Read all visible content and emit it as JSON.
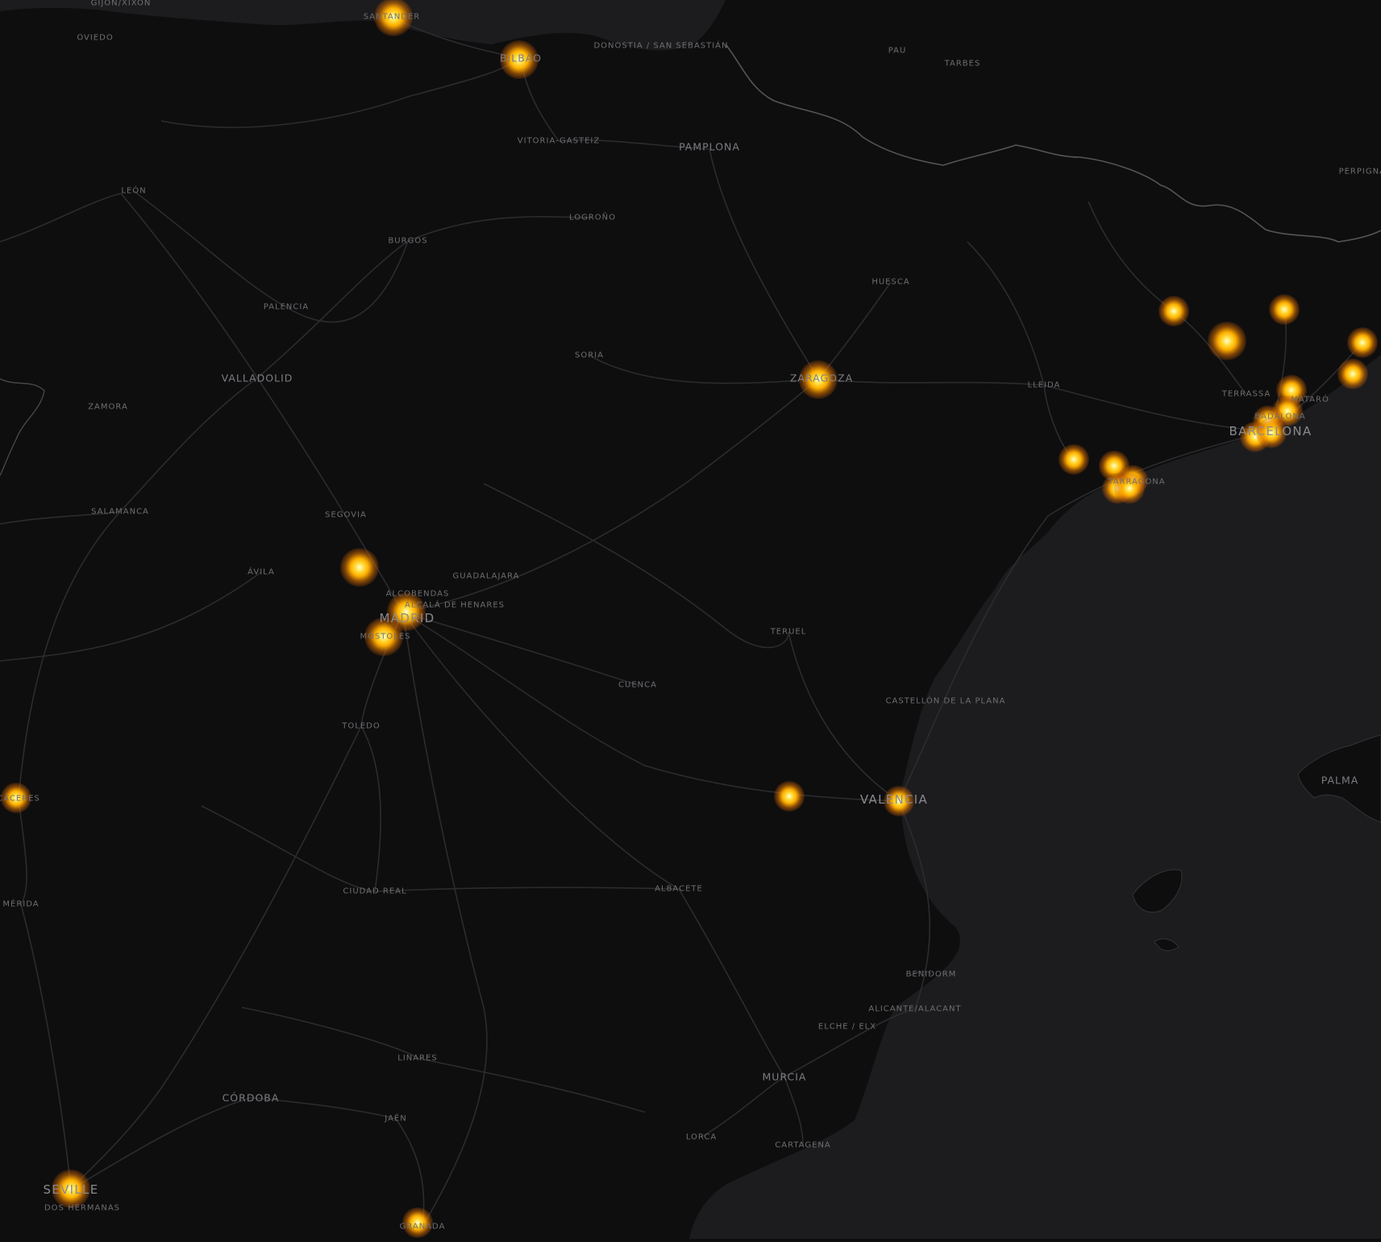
{
  "map": {
    "sea_color": "#1c1c1e",
    "land_color": "#0e0e0f",
    "road_color": "#2c2c2f",
    "border_color": "#555558",
    "heat_colors": [
      "#fffde0",
      "#ffe24a",
      "#ffb000",
      "#e67800"
    ],
    "labels": [
      {
        "text": "GIJÓN/XIXÓN",
        "class": "",
        "key": "gijon"
      },
      {
        "text": "OVIEDO",
        "class": "",
        "key": "oviedo"
      },
      {
        "text": "SANTANDER",
        "class": "",
        "key": "santander"
      },
      {
        "text": "BILBAO",
        "class": "mid",
        "key": "bilbao"
      },
      {
        "text": "DONOSTIA / SAN SEBASTIÁN",
        "class": "",
        "key": "donostia"
      },
      {
        "text": "PAU",
        "class": "",
        "key": "pau"
      },
      {
        "text": "TARBES",
        "class": "",
        "key": "tarbes"
      },
      {
        "text": "VITORIA-GASTEIZ",
        "class": "",
        "key": "vitoria"
      },
      {
        "text": "PAMPLONA",
        "class": "mid",
        "key": "pamplona"
      },
      {
        "text": "PERPIGNAN",
        "class": "",
        "key": "perpignan"
      },
      {
        "text": "LEÓN",
        "class": "",
        "key": "leon"
      },
      {
        "text": "LOGROÑO",
        "class": "",
        "key": "logrono"
      },
      {
        "text": "BURGOS",
        "class": "",
        "key": "burgos"
      },
      {
        "text": "HUESCA",
        "class": "",
        "key": "huesca"
      },
      {
        "text": "PALENCIA",
        "class": "",
        "key": "palencia"
      },
      {
        "text": "SORIA",
        "class": "",
        "key": "soria"
      },
      {
        "text": "VALLADOLID",
        "class": "mid",
        "key": "valladolid"
      },
      {
        "text": "ZARAGOZA",
        "class": "mid",
        "key": "zaragoza"
      },
      {
        "text": "LLEIDA",
        "class": "",
        "key": "lleida"
      },
      {
        "text": "ZAMORA",
        "class": "",
        "key": "zamora"
      },
      {
        "text": "TERRASSA",
        "class": "",
        "key": "terrassa"
      },
      {
        "text": "MATARÓ",
        "class": "",
        "key": "mataro"
      },
      {
        "text": "BADALONA",
        "class": "",
        "key": "badalona"
      },
      {
        "text": "BARCELONA",
        "class": "major",
        "key": "barcelona"
      },
      {
        "text": "TARRAGONA",
        "class": "",
        "key": "tarragona"
      },
      {
        "text": "SALAMANCA",
        "class": "",
        "key": "salamanca"
      },
      {
        "text": "SEGOVIA",
        "class": "",
        "key": "segovia"
      },
      {
        "text": "ÁVILA",
        "class": "",
        "key": "avila"
      },
      {
        "text": "GUADALAJARA",
        "class": "",
        "key": "guadalajara"
      },
      {
        "text": "ALCOBENDAS",
        "class": "",
        "key": "alcobendas"
      },
      {
        "text": "ALCALÁ DE HENARES",
        "class": "",
        "key": "alcala"
      },
      {
        "text": "MADRID",
        "class": "major",
        "key": "madrid"
      },
      {
        "text": "MÓSTOLES",
        "class": "",
        "key": "mostoles"
      },
      {
        "text": "TERUEL",
        "class": "",
        "key": "teruel"
      },
      {
        "text": "CUENCA",
        "class": "",
        "key": "cuenca"
      },
      {
        "text": "CASTELLÓN DE LA PLANA",
        "class": "",
        "key": "castellon"
      },
      {
        "text": "TOLEDO",
        "class": "",
        "key": "toledo"
      },
      {
        "text": "PALMA",
        "class": "mid",
        "key": "palma"
      },
      {
        "text": "CÁCERES",
        "class": "",
        "key": "caceres"
      },
      {
        "text": "VALENCIA",
        "class": "major",
        "key": "valencia"
      },
      {
        "text": "MÉRIDA",
        "class": "",
        "key": "merida"
      },
      {
        "text": "CIUDAD REAL",
        "class": "",
        "key": "ciudadreal"
      },
      {
        "text": "ALBACETE",
        "class": "",
        "key": "albacete"
      },
      {
        "text": "BENIDORM",
        "class": "",
        "key": "benidorm"
      },
      {
        "text": "ALICANTE/ALACANT",
        "class": "",
        "key": "alicante"
      },
      {
        "text": "ELCHE / ELX",
        "class": "",
        "key": "elche"
      },
      {
        "text": "LINARES",
        "class": "",
        "key": "linares"
      },
      {
        "text": "MURCIA",
        "class": "mid",
        "key": "murcia"
      },
      {
        "text": "CÓRDOBA",
        "class": "mid",
        "key": "cordoba"
      },
      {
        "text": "JAÉN",
        "class": "",
        "key": "jaen"
      },
      {
        "text": "LORCA",
        "class": "",
        "key": "lorca"
      },
      {
        "text": "CARTAGENA",
        "class": "",
        "key": "cartagena"
      },
      {
        "text": "SEVILLE",
        "class": "major",
        "key": "seville"
      },
      {
        "text": "DOS HERMANAS",
        "class": "",
        "key": "doshermanas"
      },
      {
        "text": "GRANADA",
        "class": "",
        "key": "granada"
      }
    ]
  }
}
